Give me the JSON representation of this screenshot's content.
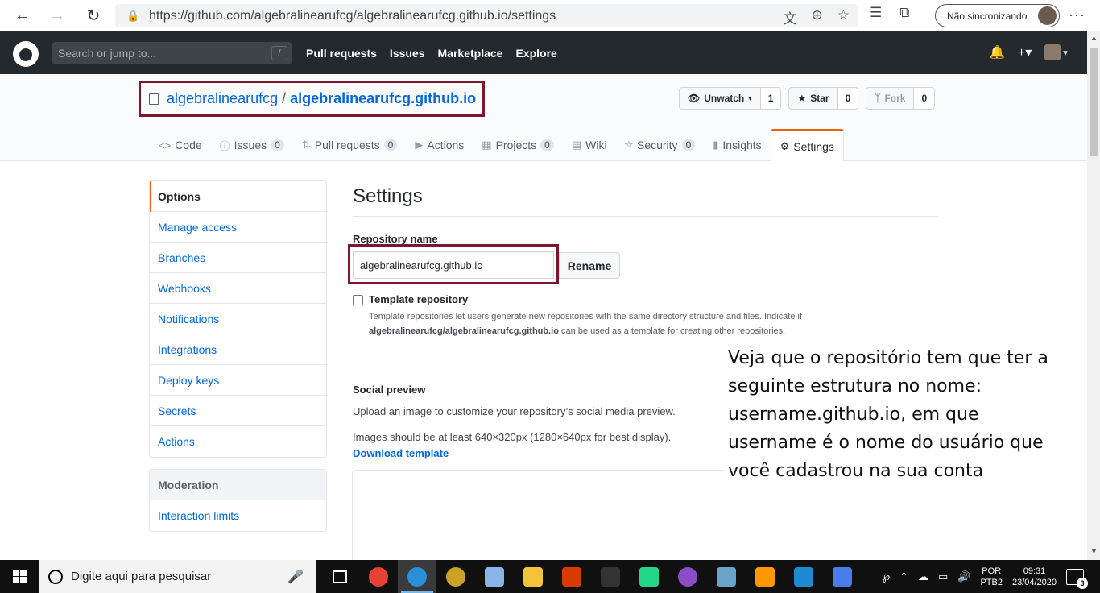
{
  "browser": {
    "url": "https://github.com/algebralinearufcg/algebralinearufcg.github.io/settings",
    "sync_label": "Não sincronizando",
    "icons": [
      "back-icon",
      "forward-icon",
      "refresh-icon",
      "lock-icon",
      "translate-icon",
      "zoom-icon",
      "favorite-icon",
      "favorites-list-icon",
      "collections-icon",
      "more-icon"
    ]
  },
  "github_header": {
    "search_placeholder": "Search or jump to...",
    "search_shortcut": "/",
    "nav": [
      "Pull requests",
      "Issues",
      "Marketplace",
      "Explore"
    ]
  },
  "repo": {
    "owner": "algebralinearufcg",
    "separator": "/",
    "name": "algebralinearufcg.github.io",
    "watch_label": "Unwatch",
    "watch_count": "1",
    "star_label": "Star",
    "star_count": "0",
    "fork_label": "Fork",
    "fork_count": "0"
  },
  "tabs": [
    {
      "label": "Code",
      "icon": "code-icon",
      "count": ""
    },
    {
      "label": "Issues",
      "icon": "issue-icon",
      "count": "0"
    },
    {
      "label": "Pull requests",
      "icon": "pull-request-icon",
      "count": "0"
    },
    {
      "label": "Actions",
      "icon": "play-icon",
      "count": ""
    },
    {
      "label": "Projects",
      "icon": "project-icon",
      "count": "0"
    },
    {
      "label": "Wiki",
      "icon": "book-icon",
      "count": ""
    },
    {
      "label": "Security",
      "icon": "shield-icon",
      "count": "0"
    },
    {
      "label": "Insights",
      "icon": "graph-icon",
      "count": ""
    },
    {
      "label": "Settings",
      "icon": "gear-icon",
      "count": ""
    }
  ],
  "side_menu": {
    "items": [
      "Options",
      "Manage access",
      "Branches",
      "Webhooks",
      "Notifications",
      "Integrations",
      "Deploy keys",
      "Secrets",
      "Actions"
    ],
    "moderation_heading": "Moderation",
    "moderation_items": [
      "Interaction limits"
    ]
  },
  "settings": {
    "title": "Settings",
    "repo_name_label": "Repository name",
    "repo_name_value": "algebralinearufcg.github.io",
    "rename_label": "Rename",
    "template_label": "Template repository",
    "template_desc_1": "Template repositories let users generate new repositories with the same directory structure and files. Indicate if",
    "template_desc_bold": "algebralinearufcg/algebralinearufcg.github.io",
    "template_desc_2": " can be used as a template for creating other repositories.",
    "social_title": "Social preview",
    "social_p1": "Upload an image to customize your repository’s social media preview.",
    "social_p2": "Images should be at least 640×320px (1280×640px for best display).",
    "download_template": "Download template"
  },
  "annotation": {
    "lines": [
      "Veja que o repositório tem que ter a",
      "seguinte estrutura no nome:",
      "username.github.io, em que",
      "username é o nome do usuário que",
      "você cadastrou na sua conta"
    ]
  },
  "taskbar": {
    "search_placeholder": "Digite aqui para pesquisar",
    "lang_top": "POR",
    "lang_bottom": "PTB2",
    "time": "09:31",
    "date": "23/04/2020",
    "notification_count": "3",
    "apps": [
      {
        "name": "task-view-icon",
        "color": "#101010"
      },
      {
        "name": "chrome-icon",
        "color": "#e94235"
      },
      {
        "name": "edge-icon",
        "color": "#2a8fd9"
      },
      {
        "name": "geogebra-icon",
        "color": "#c9a227"
      },
      {
        "name": "file-app-icon",
        "color": "#8ab4e8"
      },
      {
        "name": "file-explorer-icon",
        "color": "#f3c33b"
      },
      {
        "name": "office-icon",
        "color": "#d83b01"
      },
      {
        "name": "terminal-icon",
        "color": "#333333"
      },
      {
        "name": "pycharm-icon",
        "color": "#21d789"
      },
      {
        "name": "github-desktop-icon",
        "color": "#8a4dc8"
      },
      {
        "name": "notepad-icon",
        "color": "#6aa5c9"
      },
      {
        "name": "sublime-icon",
        "color": "#ff9800"
      },
      {
        "name": "vscode-icon",
        "color": "#1f8ad2"
      },
      {
        "name": "paint-icon",
        "color": "#4a7de8"
      }
    ]
  }
}
